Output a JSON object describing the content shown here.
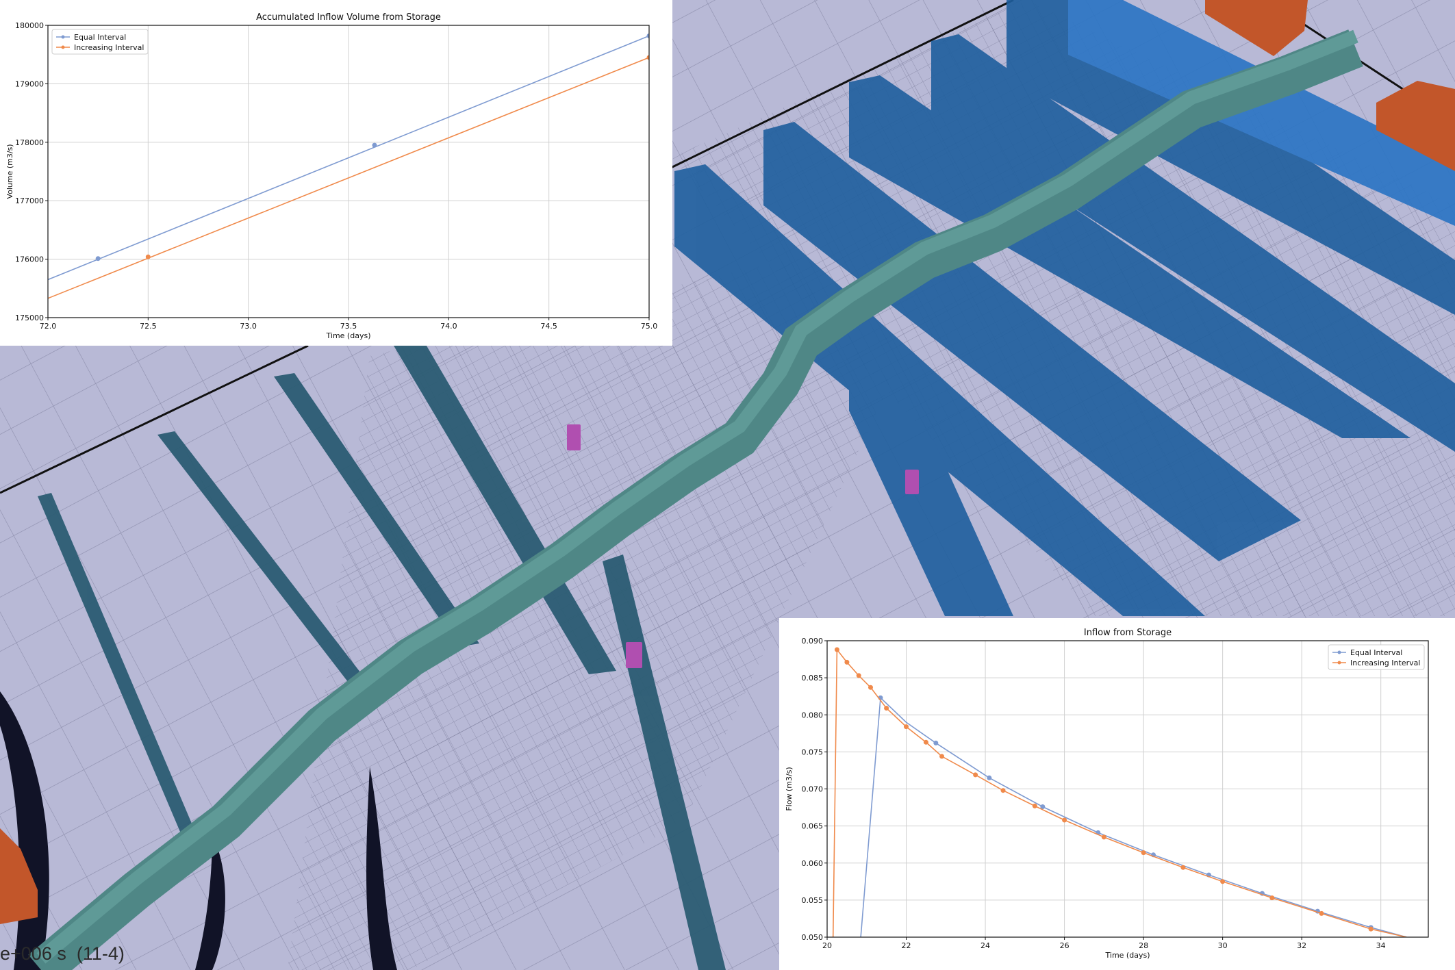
{
  "overlay": {
    "timestamp": "e+006 s  (11-4)"
  },
  "chart_data": [
    {
      "id": "accumulated",
      "type": "line",
      "title": "Accumulated Inflow Volume from Storage",
      "xlabel": "Time (days)",
      "ylabel": "Volume (m3/s)",
      "xlim": [
        72.0,
        75.0
      ],
      "ylim": [
        175000,
        180000
      ],
      "xticks": [
        "72.0",
        "72.5",
        "73.0",
        "73.5",
        "74.0",
        "74.5",
        "75.0"
      ],
      "yticks": [
        "175000",
        "176000",
        "177000",
        "178000",
        "179000",
        "180000"
      ],
      "grid": true,
      "legend": "top-left",
      "series": [
        {
          "name": "Equal Interval",
          "color": "#7f9bd1",
          "line": [
            [
              72.0,
              175650
            ],
            [
              75.0,
              179820
            ]
          ],
          "markers": [
            [
              72.25,
              176010
            ],
            [
              73.63,
              177950
            ],
            [
              75.0,
              179820
            ]
          ]
        },
        {
          "name": "Increasing Interval",
          "color": "#f08a4b",
          "line": [
            [
              72.0,
              175330
            ],
            [
              75.0,
              179450
            ]
          ],
          "markers": [
            [
              72.5,
              176040
            ],
            [
              75.0,
              179450
            ]
          ]
        }
      ]
    },
    {
      "id": "inflow",
      "type": "line",
      "title": "Inflow from Storage",
      "xlabel": "Time (days)",
      "ylabel": "Flow (m3/s)",
      "xlim": [
        20,
        35.2
      ],
      "ylim": [
        0.05,
        0.09
      ],
      "xticks": [
        "20",
        "22",
        "24",
        "26",
        "28",
        "30",
        "32",
        "34"
      ],
      "yticks": [
        "0.050",
        "0.055",
        "0.060",
        "0.065",
        "0.070",
        "0.075",
        "0.080",
        "0.085",
        "0.090"
      ],
      "grid": true,
      "legend": "top-right",
      "series": [
        {
          "name": "Equal Interval",
          "color": "#7f9bd1",
          "line": [
            [
              20.85,
              0.05
            ],
            [
              21.35,
              0.0823
            ],
            [
              22.0,
              0.079
            ],
            [
              22.75,
              0.0762
            ],
            [
              24.1,
              0.0715
            ],
            [
              25.45,
              0.0676
            ],
            [
              26.85,
              0.0641
            ],
            [
              28.25,
              0.0611
            ],
            [
              29.65,
              0.0584
            ],
            [
              31.0,
              0.0559
            ],
            [
              32.4,
              0.0535
            ],
            [
              33.75,
              0.0513
            ],
            [
              34.65,
              0.05
            ]
          ],
          "markers": [
            [
              21.35,
              0.0823
            ],
            [
              22.75,
              0.0762
            ],
            [
              24.1,
              0.0715
            ],
            [
              25.45,
              0.0676
            ],
            [
              26.85,
              0.0641
            ],
            [
              28.25,
              0.0611
            ],
            [
              29.65,
              0.0584
            ],
            [
              31.0,
              0.0559
            ],
            [
              32.4,
              0.0535
            ],
            [
              33.75,
              0.0513
            ]
          ]
        },
        {
          "name": "Increasing Interval",
          "color": "#f08a4b",
          "line": [
            [
              20.15,
              0.05
            ],
            [
              20.25,
              0.0888
            ],
            [
              20.5,
              0.0871
            ],
            [
              20.8,
              0.0853
            ],
            [
              21.1,
              0.0837
            ],
            [
              21.5,
              0.0809
            ],
            [
              22.0,
              0.0784
            ],
            [
              22.5,
              0.0763
            ],
            [
              22.9,
              0.0744
            ],
            [
              23.75,
              0.0719
            ],
            [
              24.45,
              0.0698
            ],
            [
              25.25,
              0.0677
            ],
            [
              26.0,
              0.0658
            ],
            [
              27.0,
              0.0635
            ],
            [
              28.0,
              0.0614
            ],
            [
              29.0,
              0.0594
            ],
            [
              30.0,
              0.0575
            ],
            [
              31.25,
              0.0553
            ],
            [
              32.5,
              0.0532
            ],
            [
              33.75,
              0.0511
            ],
            [
              34.65,
              0.05
            ]
          ],
          "markers": [
            [
              20.25,
              0.0888
            ],
            [
              20.5,
              0.0871
            ],
            [
              20.8,
              0.0853
            ],
            [
              21.1,
              0.0837
            ],
            [
              21.5,
              0.0809
            ],
            [
              22.0,
              0.0784
            ],
            [
              22.5,
              0.0763
            ],
            [
              22.9,
              0.0744
            ],
            [
              23.75,
              0.0719
            ],
            [
              24.45,
              0.0698
            ],
            [
              25.25,
              0.0677
            ],
            [
              26.0,
              0.0658
            ],
            [
              27.0,
              0.0635
            ],
            [
              28.0,
              0.0614
            ],
            [
              29.0,
              0.0594
            ],
            [
              30.0,
              0.0575
            ],
            [
              31.25,
              0.0553
            ],
            [
              32.5,
              0.0532
            ],
            [
              33.75,
              0.0511
            ]
          ]
        }
      ]
    }
  ]
}
